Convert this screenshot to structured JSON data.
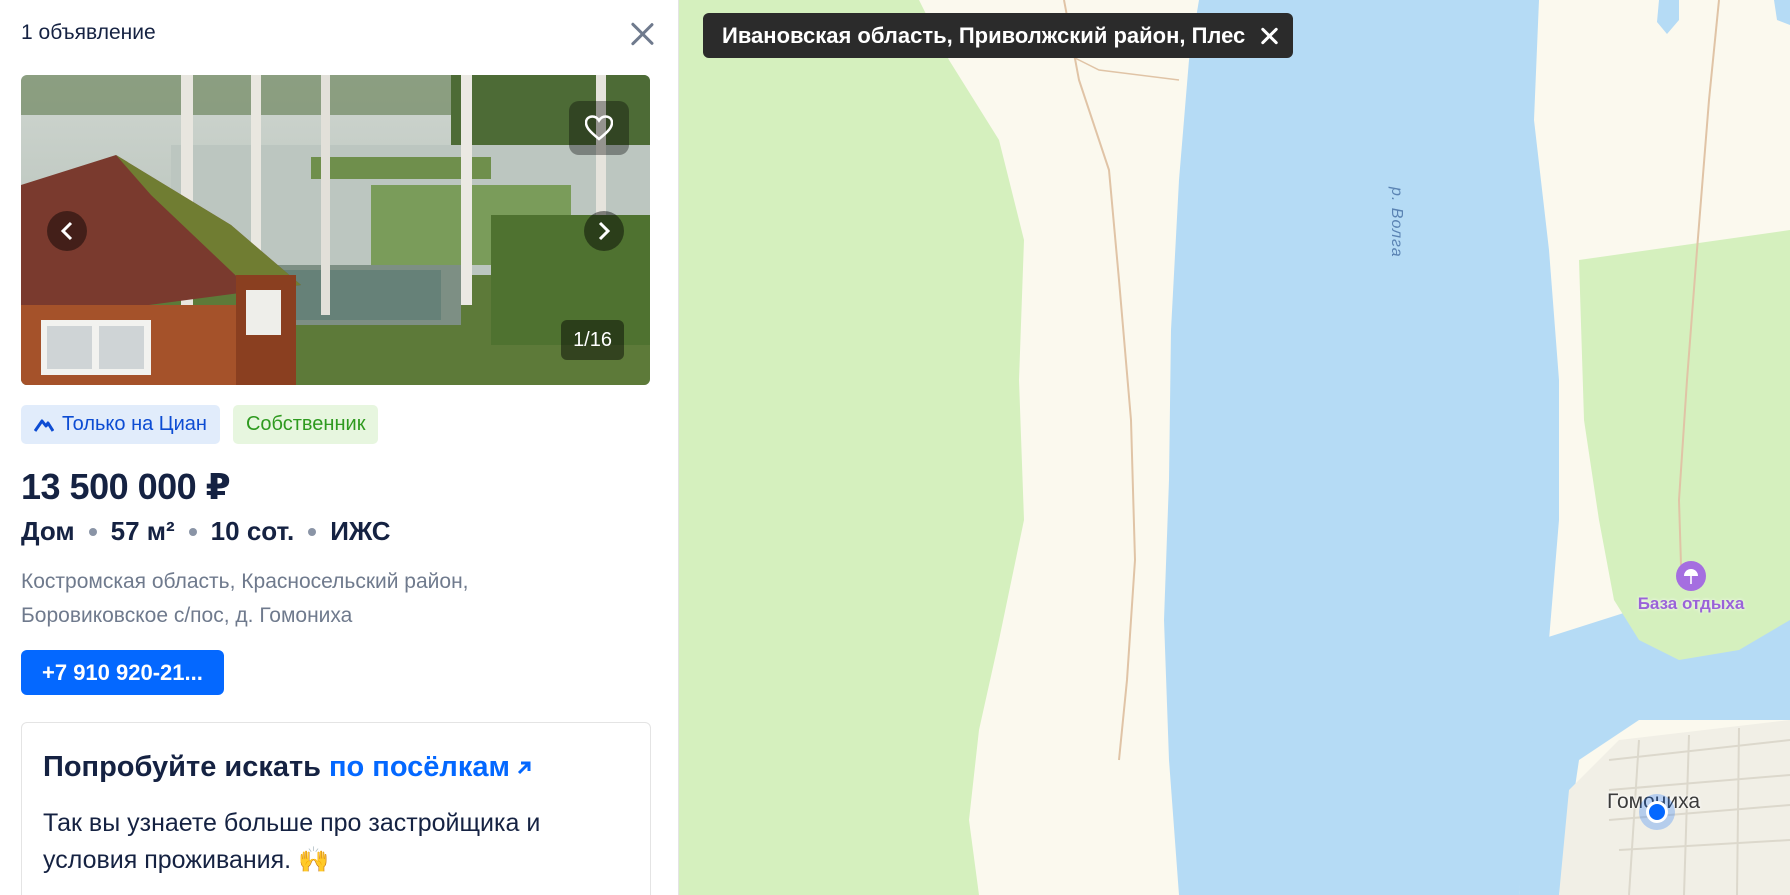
{
  "panel": {
    "count": "1 объявление",
    "close_icon": "close-icon"
  },
  "gallery": {
    "counter": "1/16",
    "prev_icon": "chevron-left-icon",
    "next_icon": "chevron-right-icon",
    "favorite_icon": "heart-icon"
  },
  "badges": {
    "cian": "Только на Циан",
    "owner": "Собственник"
  },
  "listing": {
    "price": "13 500 000 ₽",
    "type": "Дом",
    "area": "57 м²",
    "land": "10 сот.",
    "category": "ИЖС",
    "address": "Костромская область, Красносельский район, Боровиковское с/пос, д. Гомониха",
    "phone": "+7 910 920-21..."
  },
  "promo": {
    "title_prefix": "Попробуйте искать",
    "title_link": "по посёлкам",
    "text": "Так вы узнаете больше про застройщика и условия проживания. 🙌"
  },
  "map": {
    "region_filter": "Ивановская область, Приволжский район, Плес",
    "river_label": "р. Волга",
    "poi_label": "База отдыха",
    "village_label": "Гомониха",
    "colors": {
      "water": "#b5dbf5",
      "forest": "#d5f0be",
      "land": "#fbf9ee",
      "accent": "#0468ff"
    }
  }
}
